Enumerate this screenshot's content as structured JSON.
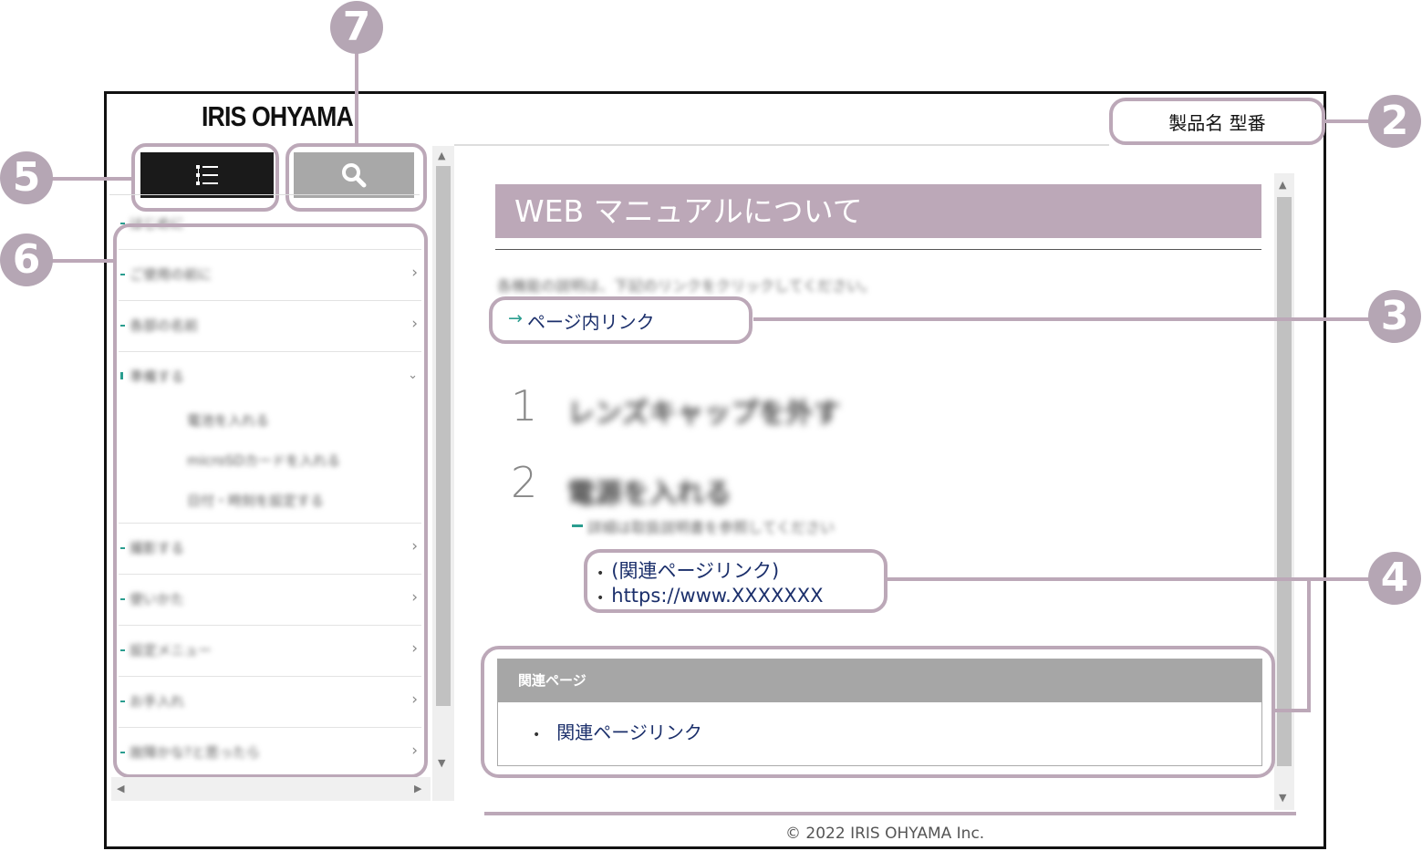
{
  "header": {
    "logo": "IRIS OHYAMA",
    "product": "製品名 型番"
  },
  "toolbar": {
    "toc_icon": "list-icon",
    "search_icon": "search-icon"
  },
  "sidebar": {
    "items": [
      {
        "label": "はじめに",
        "expanded": false
      },
      {
        "label": "ご使用の前に",
        "expanded": false
      },
      {
        "label": "各部の名前",
        "expanded": false
      },
      {
        "label": "準備する",
        "expanded": true
      },
      {
        "label": "撮影する",
        "expanded": false
      },
      {
        "label": "使いかた",
        "expanded": false
      },
      {
        "label": "設定メニュー",
        "expanded": false
      },
      {
        "label": "お手入れ",
        "expanded": false
      },
      {
        "label": "故障かな?と思ったら",
        "expanded": false
      }
    ],
    "subitems": [
      "電池を入れる",
      "microSDカードを入れる",
      "日付・時刻を設定する"
    ]
  },
  "content": {
    "title": "WEB マニュアルについて",
    "intro": "各機能の説明は、下記のリンクをクリックしてください。",
    "page_link_arrow": "→",
    "page_link": "ページ内リンク",
    "steps": [
      {
        "num": "1",
        "text": "レンズキャップを外す"
      },
      {
        "num": "2",
        "text": "電源を入れる"
      }
    ],
    "sub_note": "詳細は取扱説明書を参照してください",
    "refs": [
      "(関連ページリンク)",
      "https://www.XXXXXXX"
    ],
    "bullet": "•",
    "related_header": "関連ページ",
    "related_link": "関連ページリンク"
  },
  "footer": {
    "copyright": "© 2022 IRIS OHYAMA Inc."
  },
  "callouts": [
    "2",
    "3",
    "4",
    "5",
    "6",
    "7"
  ],
  "colors": {
    "accent_mauve": "#bca8b8",
    "callout_fill": "#b5a6b4",
    "toc_button": "#1a1a1a",
    "search_button": "#a8a8a8",
    "link": "#1b2f6b",
    "teal": "#2a9d8f"
  }
}
